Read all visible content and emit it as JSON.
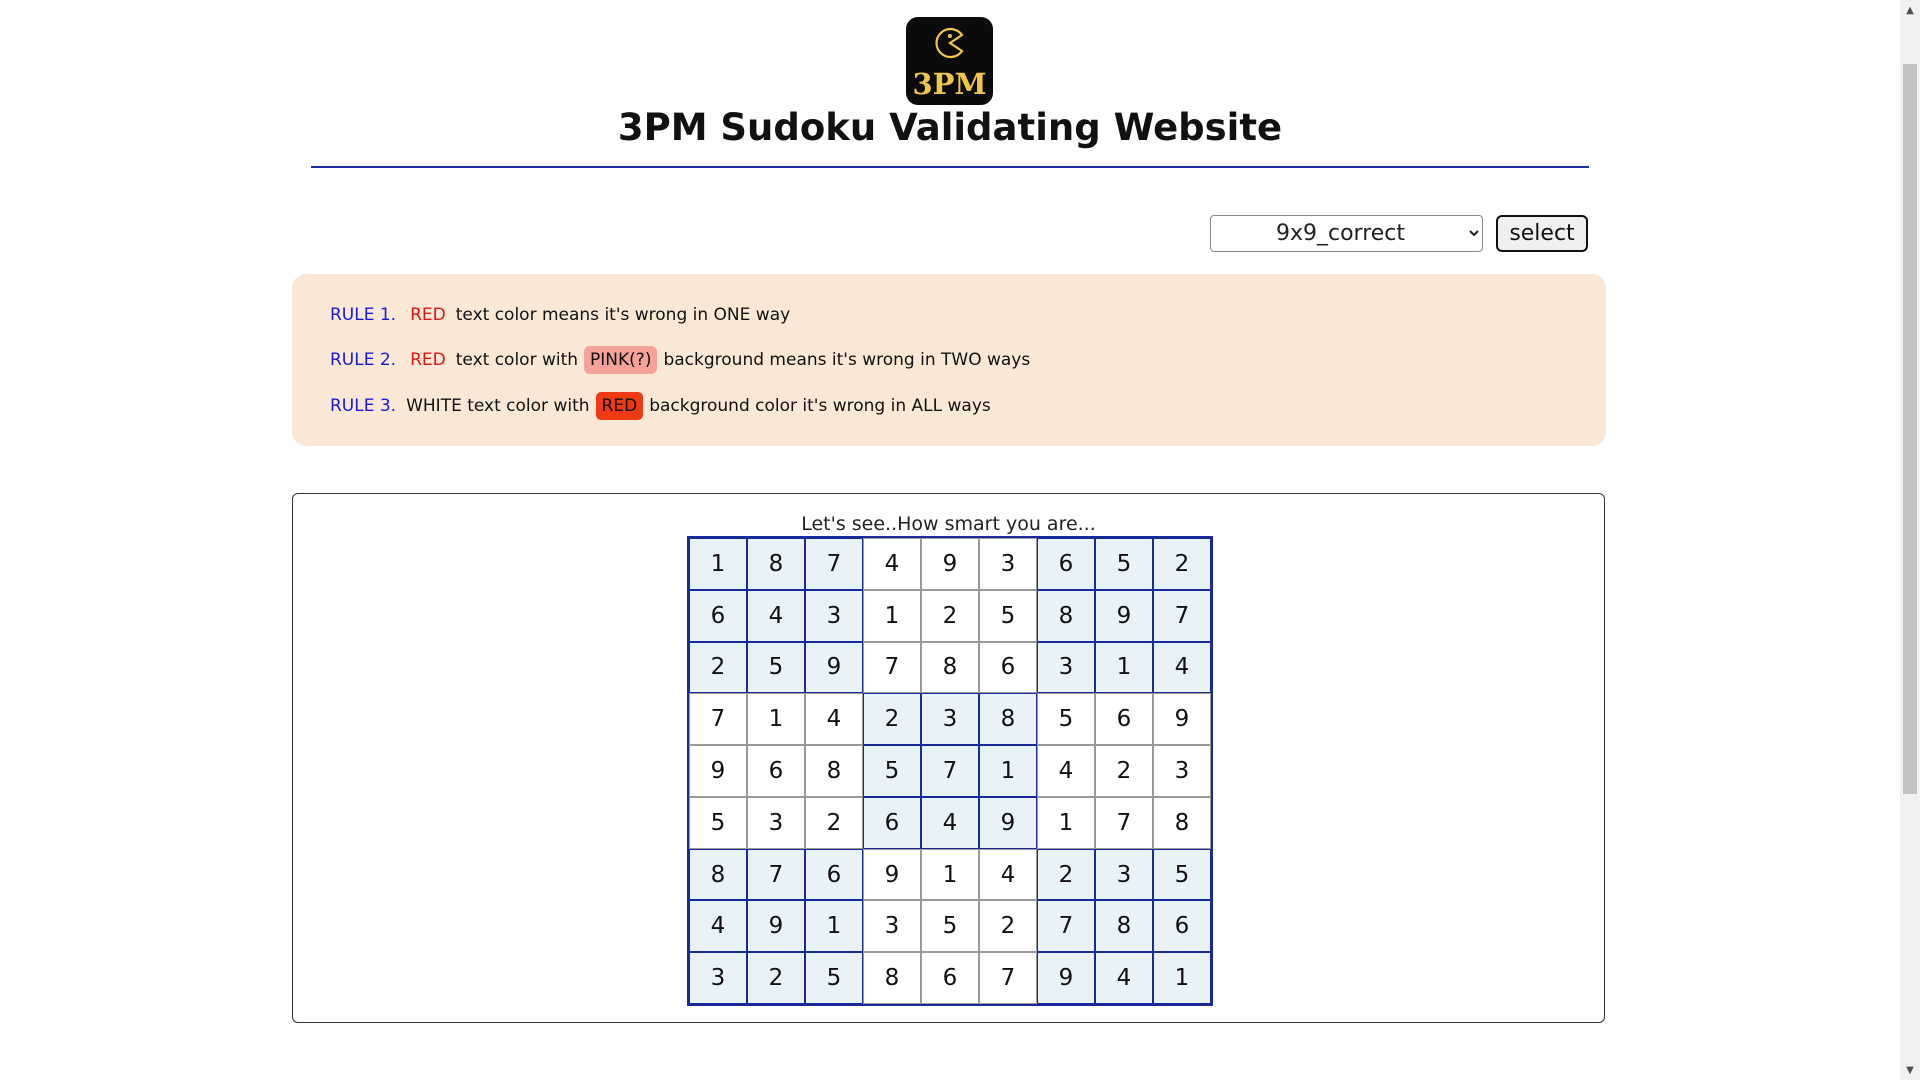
{
  "header": {
    "logo_text": "3PM",
    "title": "3PM Sudoku Validating Website"
  },
  "controls": {
    "selected_puzzle": "9x9_correct",
    "select_label": "select"
  },
  "rules": [
    {
      "num": "RULE 1.",
      "red_word": "RED",
      "text_a": "text color means it's wrong in ONE way"
    },
    {
      "num": "RULE 2.",
      "red_word": "RED",
      "text_a": "text color with",
      "chip": "PINK(?)",
      "text_b": "background means it's wrong in TWO ways"
    },
    {
      "num": "RULE 3.",
      "text_lead": "WHITE text color with",
      "chip": "RED",
      "text_b": "background color it's wrong in ALL ways"
    }
  ],
  "board": {
    "caption": "Let's see..How smart you are...",
    "rows": [
      [
        "1",
        "8",
        "7",
        "4",
        "9",
        "3",
        "6",
        "5",
        "2"
      ],
      [
        "6",
        "4",
        "3",
        "1",
        "2",
        "5",
        "8",
        "9",
        "7"
      ],
      [
        "2",
        "5",
        "9",
        "7",
        "8",
        "6",
        "3",
        "1",
        "4"
      ],
      [
        "7",
        "1",
        "4",
        "2",
        "3",
        "8",
        "5",
        "6",
        "9"
      ],
      [
        "9",
        "6",
        "8",
        "5",
        "7",
        "1",
        "4",
        "2",
        "3"
      ],
      [
        "5",
        "3",
        "2",
        "6",
        "4",
        "9",
        "1",
        "7",
        "8"
      ],
      [
        "8",
        "7",
        "6",
        "9",
        "1",
        "4",
        "2",
        "3",
        "5"
      ],
      [
        "4",
        "9",
        "1",
        "3",
        "5",
        "2",
        "7",
        "8",
        "6"
      ],
      [
        "3",
        "2",
        "5",
        "8",
        "6",
        "7",
        "9",
        "4",
        "1"
      ]
    ]
  },
  "colors": {
    "title_rule": "#1c2fa0",
    "rules_bg": "#f9e8d6",
    "rule_num": "#1a1ad6",
    "red_text": "#e01515",
    "pink_chip": "#f4a29a",
    "red_chip": "#f03a14",
    "shaded_box": "#e7f3f7",
    "box_border": "#1b2a9a"
  },
  "icons": {
    "logo_mark": "pacman-icon",
    "scroll_up": "triangle-up-icon",
    "scroll_down": "triangle-down-icon"
  }
}
